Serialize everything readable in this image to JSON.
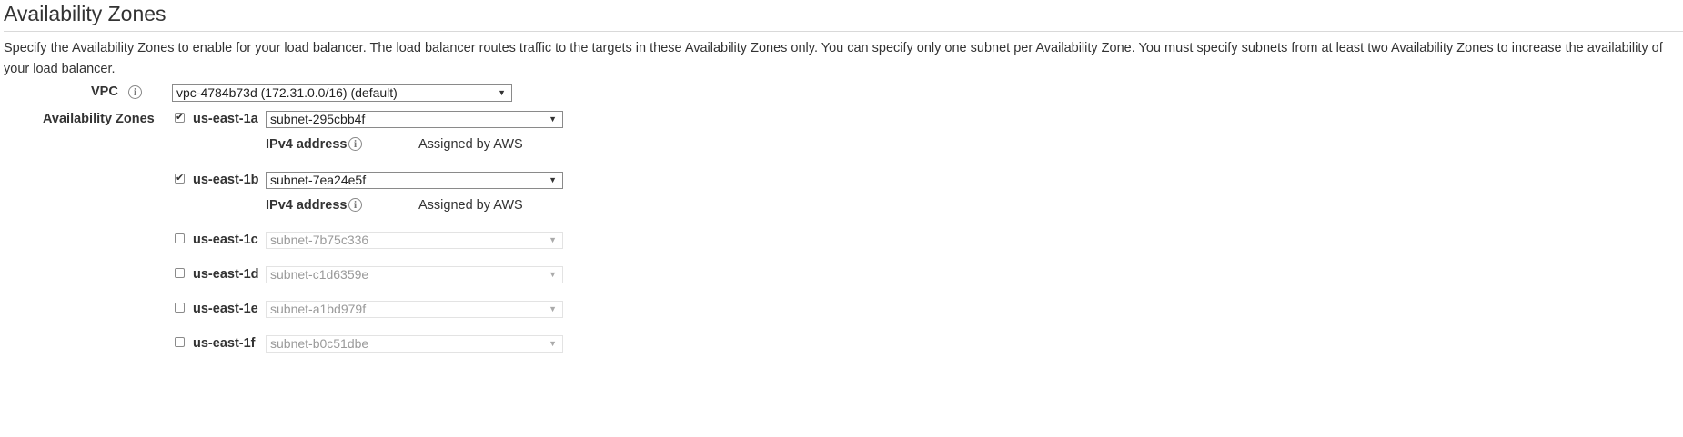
{
  "section": {
    "title": "Availability Zones",
    "description": "Specify the Availability Zones to enable for your load balancer. The load balancer routes traffic to the targets in these Availability Zones only. You can specify only one subnet per Availability Zone. You must specify subnets from at least two Availability Zones to increase the availability of your load balancer."
  },
  "vpc": {
    "label": "VPC",
    "info_icon": "info-icon",
    "selected": "vpc-4784b73d (172.31.0.0/16) (default)"
  },
  "zones_label": "Availability Zones",
  "zones": [
    {
      "name": "us-east-1a",
      "checked": true,
      "subnet": "subnet-295cbb4f",
      "ipv4_label": "IPv4 address",
      "ipv4_value": "Assigned by AWS"
    },
    {
      "name": "us-east-1b",
      "checked": true,
      "subnet": "subnet-7ea24e5f",
      "ipv4_label": "IPv4 address",
      "ipv4_value": "Assigned by AWS"
    },
    {
      "name": "us-east-1c",
      "checked": false,
      "subnet": "subnet-7b75c336"
    },
    {
      "name": "us-east-1d",
      "checked": false,
      "subnet": "subnet-c1d6359e"
    },
    {
      "name": "us-east-1e",
      "checked": false,
      "subnet": "subnet-a1bd979f"
    },
    {
      "name": "us-east-1f",
      "checked": false,
      "subnet": "subnet-b0c51dbe"
    }
  ],
  "icons": {
    "info": "i",
    "check": "✔",
    "dropdown": "▼"
  }
}
